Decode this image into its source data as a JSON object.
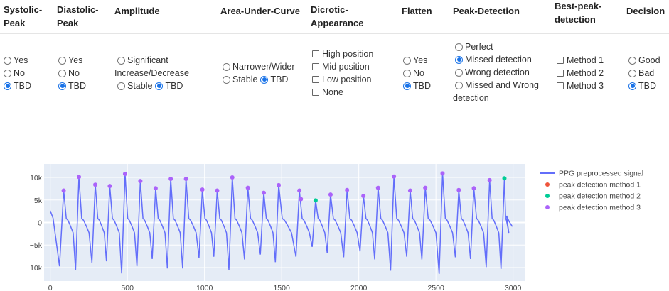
{
  "headers": {
    "systolic": [
      "Systolic-",
      "Peak"
    ],
    "diastolic": [
      "Diastolic-",
      "Peak"
    ],
    "amplitude": [
      "Amplitude"
    ],
    "auc": [
      "Area-Under-Curve"
    ],
    "dicrotic": [
      "Dicrotic-",
      "Appearance"
    ],
    "flatten": [
      "Flatten"
    ],
    "peak_detection": [
      "Peak-Detection"
    ],
    "best_peak": [
      "Best-peak-",
      "detection"
    ],
    "decision": [
      "Decision"
    ]
  },
  "systolic": {
    "options": [
      "Yes",
      "No",
      "TBD"
    ],
    "selected": "TBD"
  },
  "diastolic": {
    "options": [
      "Yes",
      "No",
      "TBD"
    ],
    "selected": "TBD"
  },
  "amplitude": {
    "opt1_line1": "Significant",
    "opt1_line2": "Increase/Decrease",
    "opt2": "Stable",
    "opt3": "TBD",
    "selected": "TBD"
  },
  "auc": {
    "opt1": "Narrower/Wider",
    "opt2": "Stable",
    "opt3": "TBD",
    "selected": "TBD"
  },
  "dicrotic": {
    "options": [
      "High position",
      "Mid position",
      "Low position",
      "None"
    ]
  },
  "flatten": {
    "options": [
      "Yes",
      "No",
      "TBD"
    ],
    "selected": "TBD"
  },
  "peak_detection": {
    "opt1": "Perfect",
    "opt2": "Missed detection",
    "opt3": "Wrong detection",
    "opt4_line1": "Missed and Wrong",
    "opt4_line2": "detection",
    "selected": "Missed detection"
  },
  "best_peak": {
    "options": [
      "Method 1",
      "Method 2",
      "Method 3"
    ]
  },
  "decision": {
    "options": [
      "Good",
      "Bad",
      "TBD"
    ],
    "selected": "TBD"
  },
  "colors": {
    "signal": "#636efa",
    "method1": "#ef553b",
    "method2": "#00cc96",
    "method3": "#ab63fa",
    "plot_bg": "#e5ecf6",
    "radio_on": "#1a73e8"
  },
  "chart_data": {
    "type": "line",
    "x_ticks": [
      "0",
      "500",
      "1000",
      "1500",
      "2000",
      "2500",
      "3000"
    ],
    "y_ticks": [
      "10k",
      "5k",
      "0",
      "−5k",
      "−10k"
    ],
    "xlim": [
      -40,
      3080
    ],
    "ylim": [
      -13000,
      13000
    ],
    "legend": [
      "PPG preprocessed signal",
      "peak detection method 1",
      "peak detection method 2",
      "peak detection method 3"
    ],
    "legend_position": "right",
    "beats": [
      {
        "x": 87,
        "y": 7100
      },
      {
        "x": 186,
        "y": 10100
      },
      {
        "x": 292,
        "y": 8400
      },
      {
        "x": 386,
        "y": 8100
      },
      {
        "x": 485,
        "y": 10800
      },
      {
        "x": 584,
        "y": 9200
      },
      {
        "x": 683,
        "y": 7600
      },
      {
        "x": 781,
        "y": 9700
      },
      {
        "x": 880,
        "y": 9700
      },
      {
        "x": 986,
        "y": 7300
      },
      {
        "x": 1082,
        "y": 7100
      },
      {
        "x": 1180,
        "y": 10000
      },
      {
        "x": 1281,
        "y": 7700
      },
      {
        "x": 1384,
        "y": 6600
      },
      {
        "x": 1481,
        "y": 8300
      },
      {
        "x": 1615,
        "y": 7100
      },
      {
        "x": 1720,
        "y": 4900
      },
      {
        "x": 1817,
        "y": 6200
      },
      {
        "x": 1924,
        "y": 7200
      },
      {
        "x": 2030,
        "y": 5900
      },
      {
        "x": 2125,
        "y": 7700
      },
      {
        "x": 2228,
        "y": 10200
      },
      {
        "x": 2333,
        "y": 7100
      },
      {
        "x": 2431,
        "y": 7700
      },
      {
        "x": 2543,
        "y": 10900
      },
      {
        "x": 2648,
        "y": 7200
      },
      {
        "x": 2746,
        "y": 7600
      },
      {
        "x": 2848,
        "y": 9400
      },
      {
        "x": 2944,
        "y": 9800
      }
    ],
    "peaks_method3": [
      {
        "x": 87,
        "y": 7100
      },
      {
        "x": 186,
        "y": 10100
      },
      {
        "x": 292,
        "y": 8400
      },
      {
        "x": 386,
        "y": 8100
      },
      {
        "x": 485,
        "y": 10800
      },
      {
        "x": 584,
        "y": 9200
      },
      {
        "x": 683,
        "y": 7600
      },
      {
        "x": 781,
        "y": 9700
      },
      {
        "x": 880,
        "y": 9700
      },
      {
        "x": 986,
        "y": 7300
      },
      {
        "x": 1082,
        "y": 7100
      },
      {
        "x": 1180,
        "y": 10000
      },
      {
        "x": 1281,
        "y": 7700
      },
      {
        "x": 1384,
        "y": 6600
      },
      {
        "x": 1481,
        "y": 8300
      },
      {
        "x": 1615,
        "y": 7100
      },
      {
        "x": 1625,
        "y": 5200
      },
      {
        "x": 1817,
        "y": 6200
      },
      {
        "x": 1924,
        "y": 7200
      },
      {
        "x": 2030,
        "y": 5900
      },
      {
        "x": 2125,
        "y": 7700
      },
      {
        "x": 2228,
        "y": 10200
      },
      {
        "x": 2333,
        "y": 7100
      },
      {
        "x": 2431,
        "y": 7700
      },
      {
        "x": 2543,
        "y": 10900
      },
      {
        "x": 2648,
        "y": 7200
      },
      {
        "x": 2746,
        "y": 7600
      },
      {
        "x": 2848,
        "y": 9400
      }
    ],
    "peaks_method2": [
      {
        "x": 1720,
        "y": 4900
      },
      {
        "x": 2944,
        "y": 9800
      }
    ],
    "peaks_method1": []
  }
}
